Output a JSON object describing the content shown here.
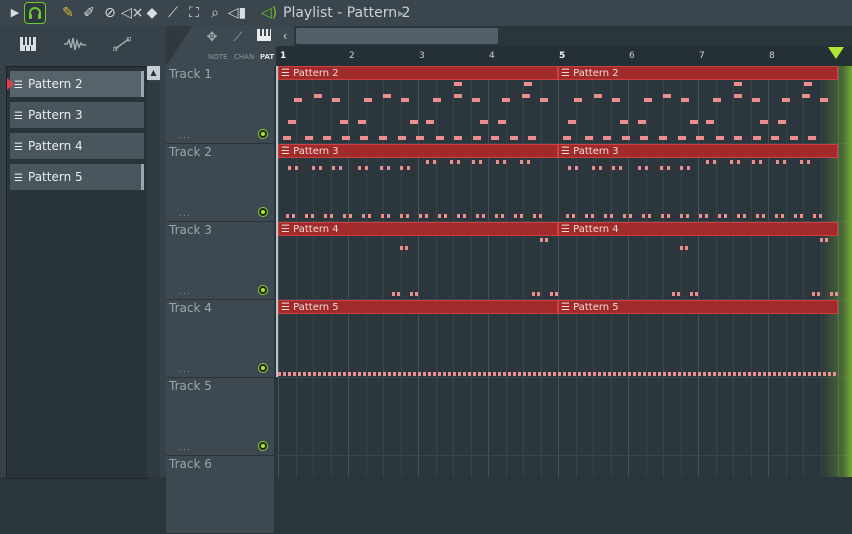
{
  "toolbar": {
    "title": "Playlist - Pattern 2",
    "icons": [
      "play-arrow-icon",
      "headphones-icon",
      "pencil-icon",
      "paint-brush-icon",
      "delete-icon",
      "mute-icon",
      "slip-icon",
      "slice-icon",
      "select-icon",
      "zoom-icon",
      "playback-icon"
    ],
    "accent": "#6fcb2d"
  },
  "browser": {
    "tools": [
      "piano-icon",
      "waveform-icon",
      "automation-icon"
    ],
    "patterns": [
      {
        "label": "Pattern 2",
        "selected": true
      },
      {
        "label": "Pattern 3",
        "selected": false
      },
      {
        "label": "Pattern 4",
        "selected": false
      },
      {
        "label": "Pattern 5",
        "selected": false
      }
    ]
  },
  "modes": {
    "note": "NOTE",
    "chan": "CHAN",
    "pat": "PAT"
  },
  "timeline": {
    "bars": [
      "1",
      "2",
      "3",
      "4",
      "5",
      "6",
      "7",
      "8"
    ]
  },
  "tracks": [
    {
      "name": "Track 1",
      "dots": "..."
    },
    {
      "name": "Track 2",
      "dots": "..."
    },
    {
      "name": "Track 3",
      "dots": "..."
    },
    {
      "name": "Track 4",
      "dots": "..."
    },
    {
      "name": "Track 5",
      "dots": "..."
    },
    {
      "name": "Track 6",
      "dots": "..."
    }
  ],
  "clips": [
    {
      "track": 0,
      "label": "Pattern 2"
    },
    {
      "track": 0,
      "label": "Pattern 2"
    },
    {
      "track": 1,
      "label": "Pattern 3"
    },
    {
      "track": 1,
      "label": "Pattern 3"
    },
    {
      "track": 2,
      "label": "Pattern 4"
    },
    {
      "track": 2,
      "label": "Pattern 4"
    },
    {
      "track": 3,
      "label": "Pattern 5"
    },
    {
      "track": 3,
      "label": "Pattern 5"
    }
  ],
  "colors": {
    "clip": "#a12b2b",
    "note": "#eb8e8e",
    "background": "#2b353c"
  }
}
